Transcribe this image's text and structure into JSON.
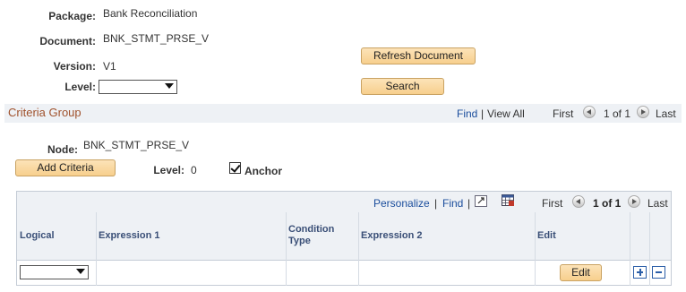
{
  "form": {
    "package_label": "Package:",
    "package_value": "Bank Reconciliation",
    "document_label": "Document:",
    "document_value": "BNK_STMT_PRSE_V",
    "version_label": "Version:",
    "version_value": "V1",
    "level_label": "Level:",
    "level_value": "",
    "refresh_label": "Refresh Document",
    "search_label": "Search"
  },
  "criteria_group": {
    "title": "Criteria Group",
    "find": "Find",
    "separator": "|",
    "view_all": "View All",
    "first": "First",
    "page": "1 of 1",
    "last": "Last",
    "node_label": "Node:",
    "node_value": "BNK_STMT_PRSE_V",
    "add_criteria_label": "Add Criteria",
    "level_label": "Level:",
    "level_value": "0",
    "anchor_label": "Anchor",
    "anchor_checked": true
  },
  "grid": {
    "personalize": "Personalize",
    "sep1": "|",
    "find": "Find",
    "sep2": "|",
    "first": "First",
    "page": "1 of 1",
    "last": "Last",
    "columns": {
      "logical": "Logical",
      "expression1": "Expression 1",
      "condition_type_line1": "Condition",
      "condition_type_line2": "Type",
      "expression2": "Expression 2",
      "edit": "Edit"
    },
    "row": {
      "logical_value": "",
      "edit_label": "Edit"
    }
  },
  "colors": {
    "header_bg": "#eef1f5",
    "link": "#1a4d9c",
    "group_title": "#a0522d",
    "button_border": "#c9a262"
  }
}
